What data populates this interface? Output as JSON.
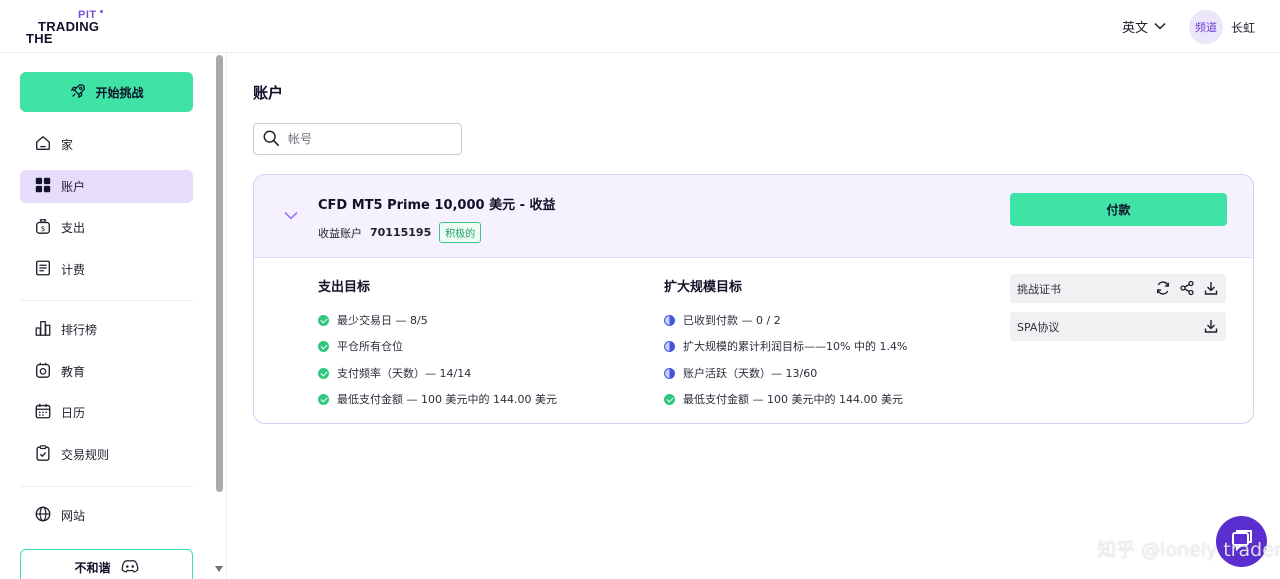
{
  "header": {
    "logo": {
      "pit": "PIT",
      "trading": "TRADING",
      "the": "THE"
    },
    "language": "英文",
    "avatar": "频道",
    "username": "长虹"
  },
  "sidebar": {
    "start_button": "开始挑战",
    "items": [
      {
        "label": "家",
        "icon": "home-icon"
      },
      {
        "label": "账户",
        "icon": "grid-icon",
        "active": true
      },
      {
        "label": "支出",
        "icon": "money-bag-icon"
      },
      {
        "label": "计费",
        "icon": "invoice-icon"
      },
      {
        "label": "排行榜",
        "icon": "leaderboard-icon"
      },
      {
        "label": "教育",
        "icon": "education-icon"
      },
      {
        "label": "日历",
        "icon": "calendar-icon"
      },
      {
        "label": "交易规则",
        "icon": "clipboard-icon"
      },
      {
        "label": "网站",
        "icon": "globe-icon"
      }
    ],
    "discord_button": "不和谐"
  },
  "main": {
    "title": "账户",
    "search_placeholder": "帐号",
    "account": {
      "title": "CFD MT5 Prime 10,000 美元 - 收益",
      "type_label": "收益账户",
      "number": "70115195",
      "status": "积极的",
      "pay_button": "付款",
      "payout_goals_title": "支出目标",
      "payout_goals": [
        "最少交易日 — 8/5",
        "平仓所有仓位",
        "支付频率（天数）— 14/14",
        "最低支付金额 — 100 美元中的 144.00 美元"
      ],
      "scaling_goals_title": "扩大规模目标",
      "scaling_goals": [
        {
          "text": "已收到付款 — 0 / 2",
          "status": "in-progress"
        },
        {
          "text": "扩大规模的累计利润目标——10% 中的 1.4%",
          "status": "in-progress"
        },
        {
          "text": "账户活跃（天数）— 13/60",
          "status": "in-progress"
        },
        {
          "text": "最低支付金额 — 100 美元中的 144.00 美元",
          "status": "done"
        }
      ],
      "documents": [
        {
          "label": "挑战证书"
        },
        {
          "label": "SPA协议"
        }
      ]
    }
  },
  "watermark": "知乎 @lonely trader",
  "colors": {
    "accent": "#3ee3a5",
    "brand_purple": "#5b2fcf",
    "active_nav": "#e7dcfc"
  }
}
